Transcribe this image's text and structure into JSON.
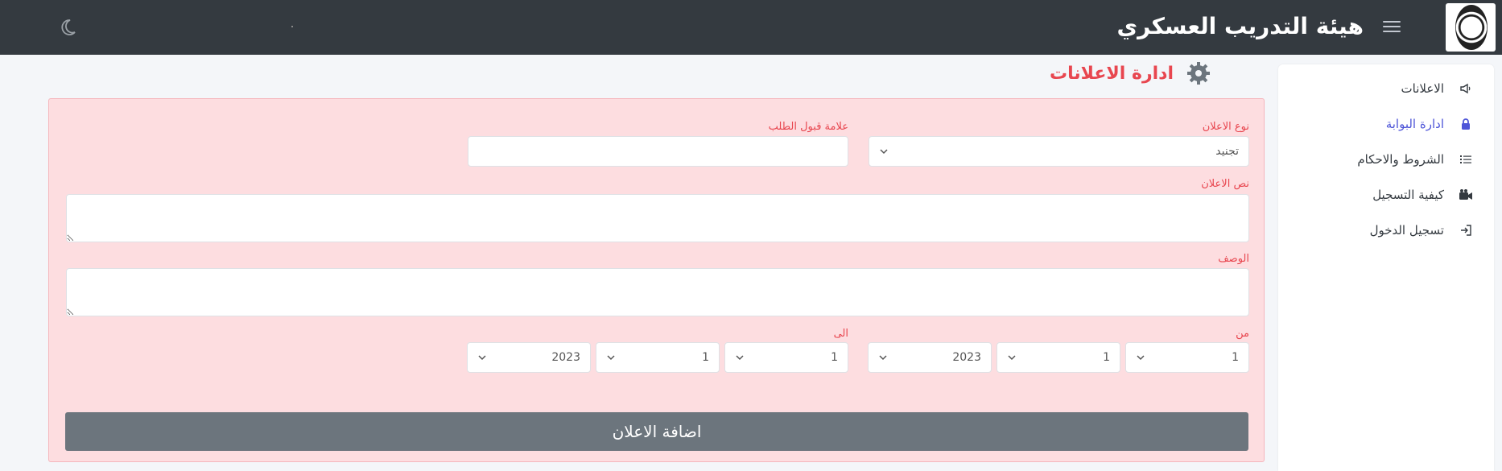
{
  "header": {
    "app_title": "هيئة التدريب العسكري",
    "logo_icon": "emblem-seal",
    "menu_icon": "hamburger-icon",
    "theme_icon": "moon-icon"
  },
  "sidebar": {
    "items": [
      {
        "label": "الاعلانات",
        "icon": "megaphone-icon",
        "active": false
      },
      {
        "label": "ادارة البوابة",
        "icon": "lock-icon",
        "active": true
      },
      {
        "label": "الشروط والاحكام",
        "icon": "list-icon",
        "active": false
      },
      {
        "label": "كيفية التسجيل",
        "icon": "video-camera-icon",
        "active": false
      },
      {
        "label": "تسجيل الدخول",
        "icon": "sign-in-icon",
        "active": false
      }
    ]
  },
  "page": {
    "title": "ادارة الاعلانات",
    "title_icon": "gear-icon"
  },
  "form": {
    "ad_type": {
      "label": "نوع الاعلان",
      "value": "تجنيد"
    },
    "acceptance_mark": {
      "label": "علامة قبول الطلب",
      "value": ""
    },
    "ad_text": {
      "label": "نص الاعلان",
      "value": ""
    },
    "description": {
      "label": "الوصف",
      "value": ""
    },
    "from": {
      "label": "من",
      "day": "1",
      "month": "1",
      "year": "2023"
    },
    "to": {
      "label": "الى",
      "day": "1",
      "month": "1",
      "year": "2023"
    },
    "submit_label": "اضافة الاعلان"
  },
  "colors": {
    "navbar": "#343a40",
    "accent_red": "#e8464f",
    "card_bg": "#fddde0",
    "button_gray": "#6c757d",
    "active_link": "#4e55d8"
  }
}
